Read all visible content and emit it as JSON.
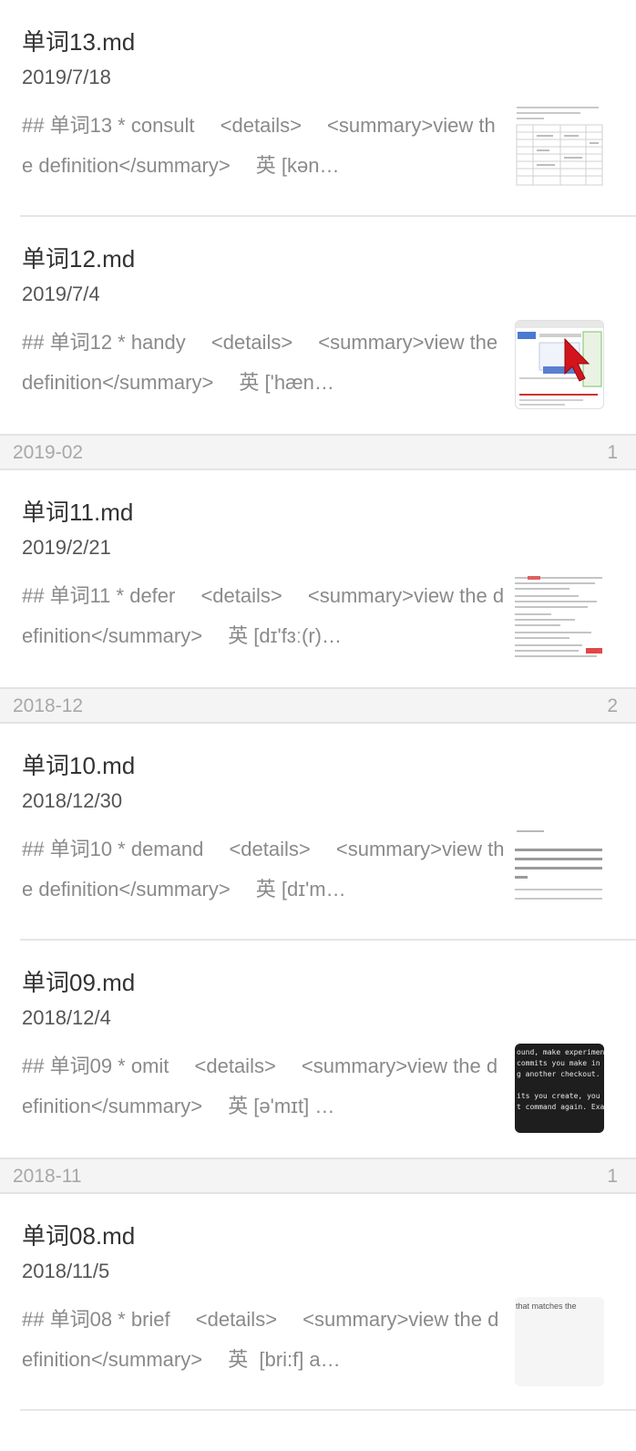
{
  "items": [
    {
      "title": "单词13.md",
      "date": "2019/7/18",
      "excerpt": "## 单词13 * consult　 <details>　 <summary>view the definition</summary>　 英 [kən…",
      "thumb_icon": "table-thumbnail-icon"
    },
    {
      "title": "单词12.md",
      "date": "2019/7/4",
      "excerpt": "## 单词12 * handy　 <details>　 <summary>view the definition</summary>　 英 ['hæn…",
      "thumb_icon": "browser-screenshot-thumbnail-icon"
    },
    {
      "title": "单词11.md",
      "date": "2019/2/21",
      "excerpt": "## 单词11 * defer　 <details>　 <summary>view the definition</summary>　 英 [dɪ'fɜː(r)…",
      "thumb_icon": "document-thumbnail-icon"
    },
    {
      "title": "单词10.md",
      "date": "2018/12/30",
      "excerpt": "## 单词10 * demand　 <details>　 <summary>view the definition</summary>　 英 [dɪ'm…",
      "thumb_icon": "chinese-text-thumbnail-icon"
    },
    {
      "title": "单词09.md",
      "date": "2018/12/4",
      "excerpt": "## 单词09 * omit　 <details>　 <summary>view the definition</summary>　 英 [ə'mɪt] …",
      "thumb_icon": "terminal-thumbnail-icon"
    },
    {
      "title": "单词08.md",
      "date": "2018/11/5",
      "excerpt": "## 单词08 * brief　 <details>　 <summary>view the definition</summary>　 英  [bri:f] a…",
      "thumb_icon": "text-snippet-thumbnail-icon"
    }
  ],
  "sections": [
    {
      "label": "2019-02",
      "count": "1"
    },
    {
      "label": "2018-12",
      "count": "2"
    },
    {
      "label": "2018-11",
      "count": "1"
    }
  ],
  "thumb_text": {
    "terminal_1": "ound, make experiment",
    "terminal_2": "commits you make in t",
    "terminal_3": "g another checkout.",
    "terminal_4": "its you create, you m",
    "terminal_5": "t command again. Exam",
    "snippet": "that matches the"
  },
  "colors": {
    "title": "#333333",
    "date": "#555555",
    "excerpt": "#8a8a8a",
    "section_bg": "#f4f4f4",
    "section_text": "#a8a8a8",
    "terminal_bg": "#1e1e1e",
    "cursor_red": "#d4141c"
  }
}
